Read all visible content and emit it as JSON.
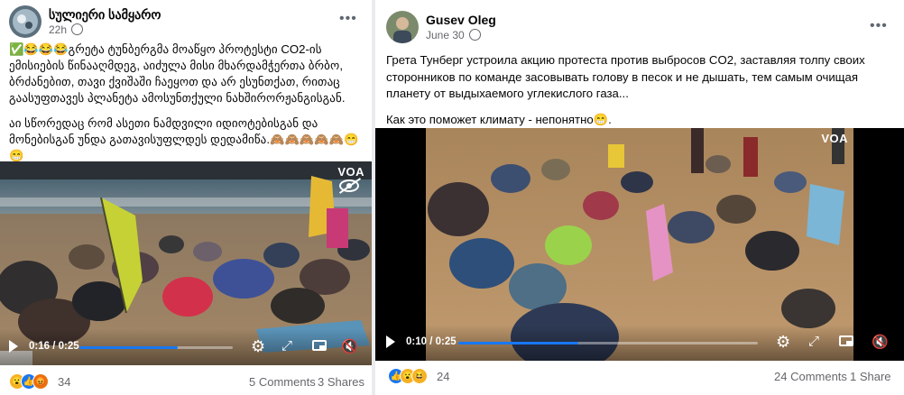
{
  "left_post": {
    "author": "სულიერი სამყარო",
    "time": "22h",
    "paragraph1": "✅😂😂😂გრეტა ტუნბერგმა მოაწყო პროტესტი CO2-ის ემისიების წინააღმდეგ, აიძულა მისი მხარდამჭერთა ბრბო, ბრძანებით, თავი ქვიშაში ჩაეყოთ და არ ესუნთქათ, რითაც გაასუფთავეს პლანეტა ამოსუნთქული ნახშირორჟანგისგან.",
    "paragraph2": "აი სწორედაც რომ ასეთი ნამდვილი იდიოტებისგან და მონებისგან უნდა გათავისუფლდეს დედამიწა.🙈🙈🙈🙈🙈😁😁",
    "video": {
      "time": "0:16 / 0:25",
      "progress": 0.64,
      "watermark": "VOA"
    },
    "reactions_count": "34",
    "comments": "5 Comments",
    "shares": "3 Shares"
  },
  "right_post": {
    "author": "Gusev Oleg",
    "time": "June 30",
    "paragraph1": "Грета Тунберг устроила акцию протеста против выбросов CO2, заставляя толпу своих сторонников по команде засовывать голову в песок и не дышать, тем самым очищая планету от выдыхаемого углекислого газа...",
    "paragraph2": "Как это поможет климату - непонятно😁.",
    "video": {
      "time": "0:10 / 0:25",
      "progress": 0.4,
      "watermark": "VOA"
    },
    "reactions_count": "24",
    "comments": "24 Comments",
    "shares": "1 Share"
  },
  "icons": [
    "globe-icon",
    "more-icon",
    "play-icon",
    "settings-icon",
    "fullscreen-icon",
    "pip-icon",
    "mute-icon",
    "hide-icon",
    "like-icon",
    "wow-icon",
    "haha-icon",
    "angry-icon"
  ],
  "colors": {
    "accent": "#1877f2",
    "secondary_text": "#65676b",
    "divider": "#e9ebee"
  }
}
